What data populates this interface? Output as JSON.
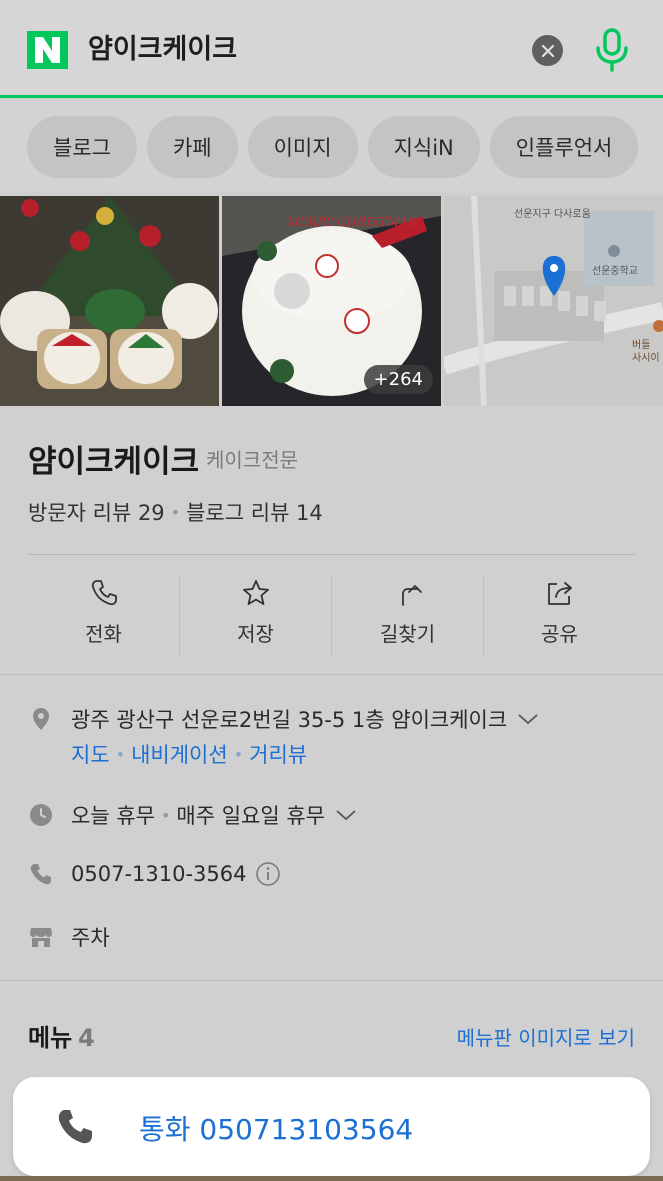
{
  "search": {
    "logo_letter": "N",
    "query": "얌이크케이크"
  },
  "tabs": [
    "블로그",
    "카페",
    "이미지",
    "지식iN",
    "인플루언서"
  ],
  "gallery": {
    "photo1_alt": "",
    "photo2_text": "MERRY CHRISTMAS",
    "more_count": "+264",
    "map_labels": [
      "선운지구 다사로움",
      "선운중학교",
      "버들",
      "사시이"
    ]
  },
  "place": {
    "name": "얌이크케이크",
    "category": "케이크전문",
    "visitor_reviews": "방문자 리뷰 29",
    "blog_reviews": "블로그 리뷰 14"
  },
  "actions": [
    {
      "label": "전화",
      "icon": "phone-icon"
    },
    {
      "label": "저장",
      "icon": "star-icon"
    },
    {
      "label": "길찾기",
      "icon": "directions-icon"
    },
    {
      "label": "공유",
      "icon": "share-icon"
    }
  ],
  "details": {
    "address": "광주 광산구 선운로2번길 35-5 1층 얌이크케이크",
    "links": [
      "지도",
      "내비게이션",
      "거리뷰"
    ],
    "hours_today": "오늘 휴무",
    "hours_note": "매주 일요일 휴무",
    "phone": "0507-1310-3564",
    "parking": "주차"
  },
  "menu": {
    "title": "메뉴",
    "count": "4",
    "view_link": "메뉴판 이미지로 보기"
  },
  "call_bar": {
    "label": "통화 050713103564"
  },
  "colors": {
    "naver_green": "#03c75a",
    "link_blue": "#1c6fd3"
  }
}
